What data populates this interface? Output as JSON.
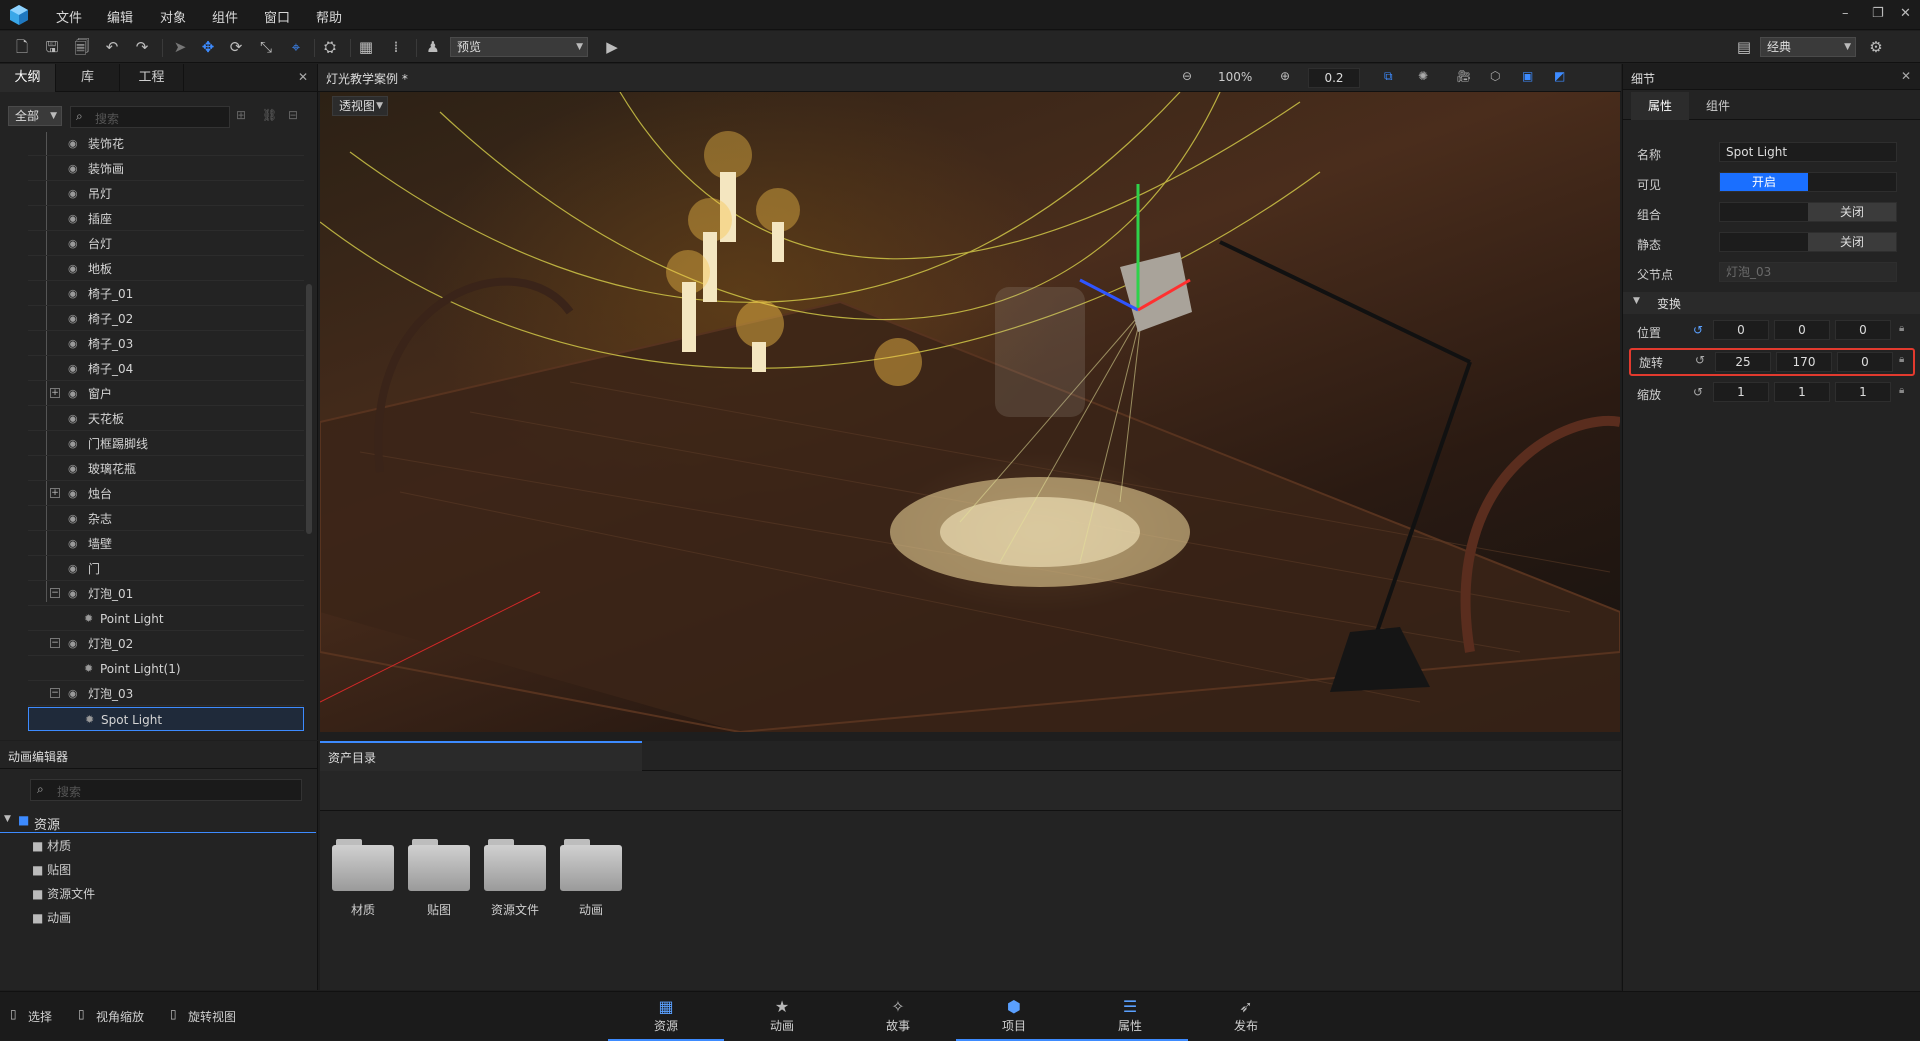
{
  "menu": [
    "文件",
    "编辑",
    "对象",
    "组件",
    "窗口",
    "帮助"
  ],
  "toolbar": {
    "preview_label": "预览",
    "layout_label": "经典"
  },
  "outline": {
    "tabs": [
      "大纲",
      "库",
      "工程"
    ],
    "filter_value": "全部",
    "search_placeholder": "搜索",
    "items": [
      {
        "label": "装饰花",
        "indent": 0,
        "expand": ""
      },
      {
        "label": "装饰画",
        "indent": 0,
        "expand": ""
      },
      {
        "label": "吊灯",
        "indent": 0,
        "expand": ""
      },
      {
        "label": "插座",
        "indent": 0,
        "expand": ""
      },
      {
        "label": "台灯",
        "indent": 0,
        "expand": ""
      },
      {
        "label": "地板",
        "indent": 0,
        "expand": ""
      },
      {
        "label": "椅子_01",
        "indent": 0,
        "expand": ""
      },
      {
        "label": "椅子_02",
        "indent": 0,
        "expand": ""
      },
      {
        "label": "椅子_03",
        "indent": 0,
        "expand": ""
      },
      {
        "label": "椅子_04",
        "indent": 0,
        "expand": ""
      },
      {
        "label": "窗户",
        "indent": 0,
        "expand": "+"
      },
      {
        "label": "天花板",
        "indent": 0,
        "expand": ""
      },
      {
        "label": "门框踢脚线",
        "indent": 0,
        "expand": ""
      },
      {
        "label": "玻璃花瓶",
        "indent": 0,
        "expand": ""
      },
      {
        "label": "烛台",
        "indent": 0,
        "expand": "+"
      },
      {
        "label": "杂志",
        "indent": 0,
        "expand": ""
      },
      {
        "label": "墙壁",
        "indent": 0,
        "expand": ""
      },
      {
        "label": "门",
        "indent": 0,
        "expand": ""
      },
      {
        "label": "灯泡_01",
        "indent": 0,
        "expand": "−"
      },
      {
        "label": "Point Light",
        "indent": 1,
        "expand": ""
      },
      {
        "label": "灯泡_02",
        "indent": 0,
        "expand": "−"
      },
      {
        "label": "Point Light(1)",
        "indent": 1,
        "expand": ""
      },
      {
        "label": "灯泡_03",
        "indent": 0,
        "expand": "−"
      },
      {
        "label": "Spot Light",
        "indent": 1,
        "expand": ""
      }
    ]
  },
  "viewport": {
    "title": "灯光教学案例 *",
    "view_mode": "透视图",
    "zoom": "100%",
    "snap_value": "0.2"
  },
  "details": {
    "panel_title": "细节",
    "tabs": [
      "属性",
      "组件"
    ],
    "name_label": "名称",
    "name_value": "Spot Light",
    "visible_label": "可见",
    "visible_value": "开启",
    "group_label": "组合",
    "group_value": "关闭",
    "static_label": "静态",
    "static_value": "关闭",
    "parent_label": "父节点",
    "parent_value": "灯泡_03",
    "transform_label": "变换",
    "position_label": "位置",
    "position": [
      "0",
      "0",
      "0"
    ],
    "rotation_label": "旋转",
    "rotation": [
      "25",
      "170",
      "0"
    ],
    "scale_label": "缩放",
    "scale": [
      "1",
      "1",
      "1"
    ],
    "accent_color": "#1a6fff",
    "highlight_color": "#e23a2e"
  },
  "anim_editor": {
    "title": "动画编辑器",
    "search_placeholder": "搜索",
    "root": "资源",
    "children": [
      "材质",
      "贴图",
      "资源文件",
      "动画"
    ]
  },
  "asset_catalog": {
    "title": "资产目录",
    "folders": [
      "材质",
      "贴图",
      "资源文件",
      "动画"
    ]
  },
  "status": {
    "tools": [
      "选择",
      "视角缩放",
      "旋转视图"
    ]
  },
  "bottom_tabs": [
    {
      "label": "资源",
      "icon": "asset-icon"
    },
    {
      "label": "动画",
      "icon": "star-icon"
    },
    {
      "label": "故事",
      "icon": "wand-icon"
    },
    {
      "label": "项目",
      "icon": "box-icon"
    },
    {
      "label": "属性",
      "icon": "sliders-icon"
    },
    {
      "label": "发布",
      "icon": "rocket-icon"
    }
  ]
}
